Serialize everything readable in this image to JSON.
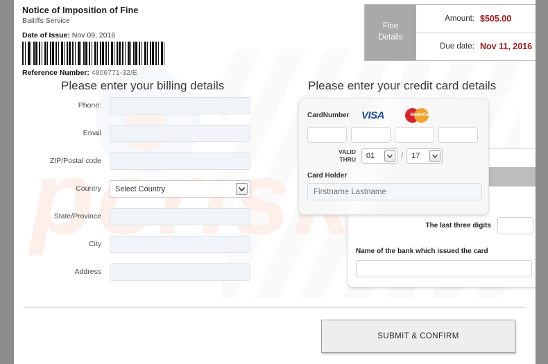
{
  "document": {
    "title": "Notice of Imposition of Fine",
    "subtitle": "Bailiffs Service",
    "issue_label": "Date of Issue:",
    "issue_date": "Nov 09, 2016",
    "reference_label": "Reference Number:",
    "reference_value": "4806771-32/E"
  },
  "fine_details": {
    "box_label": "Fine Details",
    "box_label_line1": "Fine",
    "box_label_line2": "Details",
    "rows": [
      {
        "key": "Amount:",
        "value": "$505.00"
      },
      {
        "key": "Due date:",
        "value": "Nov 11, 2016"
      }
    ]
  },
  "billing": {
    "heading": "Please enter your billing details",
    "fields": [
      {
        "label": "Phone:",
        "value": "",
        "placeholder": "",
        "type": "text"
      },
      {
        "label": "Email",
        "value": "",
        "placeholder": "",
        "type": "text"
      },
      {
        "label": "ZIP/Postal code",
        "value": "",
        "placeholder": "",
        "type": "text"
      },
      {
        "label": "Country",
        "value": "Select Country",
        "placeholder": "",
        "type": "select"
      },
      {
        "label": "State/Province",
        "value": "",
        "placeholder": "",
        "type": "text"
      },
      {
        "label": "City",
        "value": "",
        "placeholder": "",
        "type": "text"
      },
      {
        "label": "Address",
        "value": "",
        "placeholder": "",
        "type": "text"
      }
    ],
    "country_selected": "Select Country"
  },
  "credit_card": {
    "heading": "Please enter your credit card details",
    "card_number_label": "CardNumber",
    "brands": [
      {
        "name": "visa-logo",
        "text": "VISA"
      },
      {
        "name": "mastercard-logo",
        "text": "MasterCard"
      }
    ],
    "card_number_segments": [
      "",
      "",
      "",
      ""
    ],
    "valid_thru_label_line1": "VALID",
    "valid_thru_label_line2": "THRU",
    "expiry_month": "01",
    "expiry_year": "17",
    "expiry_separator": "/",
    "card_holder_label": "Card Holder",
    "card_holder_placeholder": "Firstname Lastname",
    "card_holder_value": "",
    "cvv_label": "The last three digits",
    "cvv_value": "",
    "bank_label": "Name of the bank which issued the card",
    "bank_value": ""
  },
  "footer": {
    "submit_label": "SUBMIT & CONFIRM"
  },
  "watermark": {
    "text": "pcrisk.com"
  },
  "colors": {
    "accent_red": "#a81818",
    "fine_label_gray": "#a9a9a9",
    "visa_blue": "#1a4f9c",
    "mastercard_red": "#d8232a",
    "mastercard_orange": "#f2a22c",
    "page_margin_gray": "#8c8c8c"
  }
}
